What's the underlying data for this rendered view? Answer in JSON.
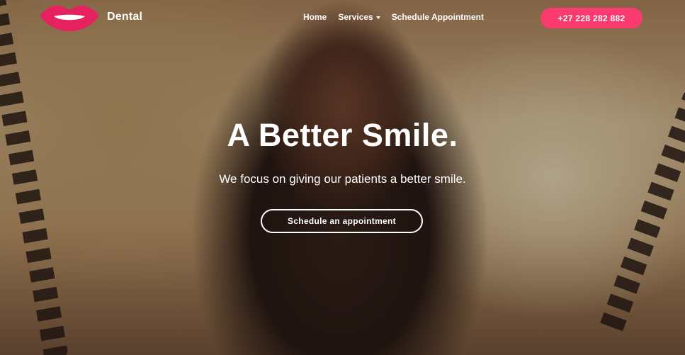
{
  "brand": {
    "name": "Dental",
    "logo_icon": "lips-logo-icon",
    "logo_color": "#e6215f"
  },
  "nav": {
    "items": [
      {
        "label": "Home"
      },
      {
        "label": "Services",
        "has_dropdown": true
      },
      {
        "label": "Schedule Appointment"
      }
    ],
    "phone_label": "+27 228 282 882"
  },
  "hero": {
    "headline": "A Better Smile.",
    "subline": "We focus on giving our patients a better smile.",
    "cta_label": "Schedule an appointment",
    "background_image": "smiling-woman-on-swing-photo"
  },
  "colors": {
    "accent": "#fb3b70",
    "text": "#ffffff"
  }
}
